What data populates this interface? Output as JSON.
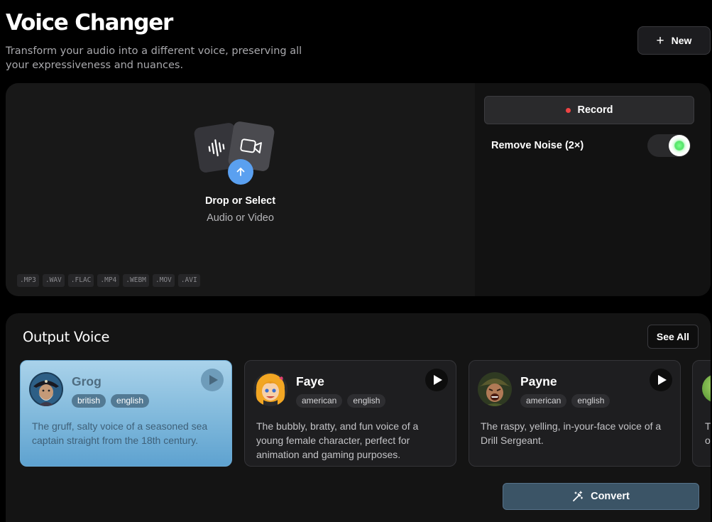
{
  "header": {
    "title": "Voice Changer",
    "subtitle": "Transform your audio into a different voice, preserving all your expressiveness and nuances.",
    "new_button_label": "New"
  },
  "upload": {
    "drop_title": "Drop or Select",
    "drop_subtitle": "Audio or Video",
    "formats": [
      ".MP3",
      ".WAV",
      ".FLAC",
      ".MP4",
      ".WEBM",
      ".MOV",
      ".AVI"
    ],
    "icons": [
      "waveform-icon",
      "video-camera-icon",
      "upload-arrow-icon"
    ]
  },
  "controls": {
    "record_label": "Record",
    "noise_label": "Remove Noise (2×)",
    "noise_enabled": true
  },
  "voices_section": {
    "heading": "Output Voice",
    "see_all_label": "See All",
    "voices": [
      {
        "name": "Grog",
        "tags": [
          "british",
          "english"
        ],
        "description": "The gruff, salty voice of a seasoned sea captain straight from the 18th century.",
        "selected": true
      },
      {
        "name": "Faye",
        "tags": [
          "american",
          "english"
        ],
        "description": "The bubbly, bratty, and fun voice of a young female character, perfect for animation and gaming purposes.",
        "selected": false
      },
      {
        "name": "Payne",
        "tags": [
          "american",
          "english"
        ],
        "description": "The raspy, yelling, in-your-face voice of a Drill Sergeant.",
        "selected": false
      }
    ],
    "partial_card_text": "T\no"
  },
  "convert_label": "Convert",
  "colors": {
    "accent_blue": "#5aa0f0",
    "record_dot": "#ef4444",
    "toggle_on": "#55e56a",
    "convert_bg": "#3b5466"
  }
}
